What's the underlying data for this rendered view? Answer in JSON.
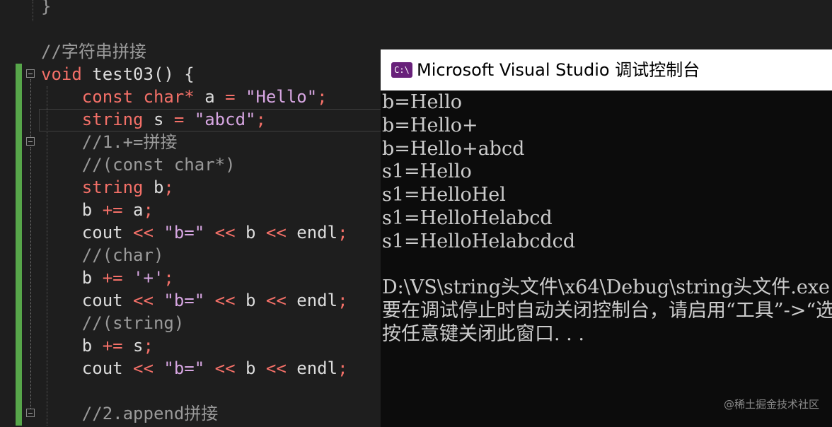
{
  "editor": {
    "lines": [
      [
        {
          "t": "}",
          "c": "cm"
        }
      ],
      [],
      [
        {
          "t": "//字符串拼接",
          "c": "cm"
        }
      ],
      [
        {
          "t": "void",
          "c": "kw"
        },
        {
          "t": " test03() {",
          "c": ""
        }
      ],
      [
        {
          "t": "    const",
          "c": "kw"
        },
        {
          "t": " ",
          "c": ""
        },
        {
          "t": "char*",
          "c": "kw"
        },
        {
          "t": " a ",
          "c": ""
        },
        {
          "t": "=",
          "c": "op"
        },
        {
          "t": " ",
          "c": ""
        },
        {
          "t": "\"Hello\"",
          "c": "str"
        },
        {
          "t": ";",
          "c": "op"
        }
      ],
      [
        {
          "t": "    string",
          "c": "kw"
        },
        {
          "t": " s ",
          "c": ""
        },
        {
          "t": "=",
          "c": "op"
        },
        {
          "t": " ",
          "c": ""
        },
        {
          "t": "\"abcd\"",
          "c": "str"
        },
        {
          "t": ";",
          "c": "op"
        }
      ],
      [
        {
          "t": "    //1.+=拼接",
          "c": "cm"
        }
      ],
      [
        {
          "t": "    //(const char*)",
          "c": "cm"
        }
      ],
      [
        {
          "t": "    string",
          "c": "kw"
        },
        {
          "t": " b",
          "c": ""
        },
        {
          "t": ";",
          "c": "op"
        }
      ],
      [
        {
          "t": "    b ",
          "c": ""
        },
        {
          "t": "+=",
          "c": "op"
        },
        {
          "t": " a",
          "c": ""
        },
        {
          "t": ";",
          "c": "op"
        }
      ],
      [
        {
          "t": "    cout ",
          "c": ""
        },
        {
          "t": "<<",
          "c": "op"
        },
        {
          "t": " ",
          "c": ""
        },
        {
          "t": "\"b=\"",
          "c": "str"
        },
        {
          "t": " ",
          "c": ""
        },
        {
          "t": "<<",
          "c": "op"
        },
        {
          "t": " b ",
          "c": ""
        },
        {
          "t": "<<",
          "c": "op"
        },
        {
          "t": " endl",
          "c": ""
        },
        {
          "t": ";",
          "c": "op"
        }
      ],
      [
        {
          "t": "    //(char)",
          "c": "cm"
        }
      ],
      [
        {
          "t": "    b ",
          "c": ""
        },
        {
          "t": "+=",
          "c": "op"
        },
        {
          "t": " ",
          "c": ""
        },
        {
          "t": "'+'",
          "c": "str"
        },
        {
          "t": ";",
          "c": "op"
        }
      ],
      [
        {
          "t": "    cout ",
          "c": ""
        },
        {
          "t": "<<",
          "c": "op"
        },
        {
          "t": " ",
          "c": ""
        },
        {
          "t": "\"b=\"",
          "c": "str"
        },
        {
          "t": " ",
          "c": ""
        },
        {
          "t": "<<",
          "c": "op"
        },
        {
          "t": " b ",
          "c": ""
        },
        {
          "t": "<<",
          "c": "op"
        },
        {
          "t": " endl",
          "c": ""
        },
        {
          "t": ";",
          "c": "op"
        }
      ],
      [
        {
          "t": "    //(string)",
          "c": "cm"
        }
      ],
      [
        {
          "t": "    b ",
          "c": ""
        },
        {
          "t": "+=",
          "c": "op"
        },
        {
          "t": " s",
          "c": ""
        },
        {
          "t": ";",
          "c": "op"
        }
      ],
      [
        {
          "t": "    cout ",
          "c": ""
        },
        {
          "t": "<<",
          "c": "op"
        },
        {
          "t": " ",
          "c": ""
        },
        {
          "t": "\"b=\"",
          "c": "str"
        },
        {
          "t": " ",
          "c": ""
        },
        {
          "t": "<<",
          "c": "op"
        },
        {
          "t": " b ",
          "c": ""
        },
        {
          "t": "<<",
          "c": "op"
        },
        {
          "t": " endl",
          "c": ""
        },
        {
          "t": ";",
          "c": "op"
        }
      ],
      [],
      [
        {
          "t": "    //2.append拼接",
          "c": "cm"
        }
      ]
    ]
  },
  "console": {
    "title": "Microsoft Visual Studio 调试控制台",
    "icon_text": "C:\\",
    "lines": [
      "b=Hello",
      "b=Hello+",
      "b=Hello+abcd",
      "s1=Hello",
      "s1=HelloHel",
      "s1=HelloHelabcd",
      "s1=HelloHelabcdcd",
      "",
      "D:\\VS\\string头文件\\x64\\Debug\\string头文件.exe",
      "要在调试停止时自动关闭控制台，请启用“工具”->“选项”->“调试”->“调试停止时自动关闭控制台”。",
      "按任意键关闭此窗口. . ."
    ]
  },
  "watermark": "@稀土掘金技术社区"
}
